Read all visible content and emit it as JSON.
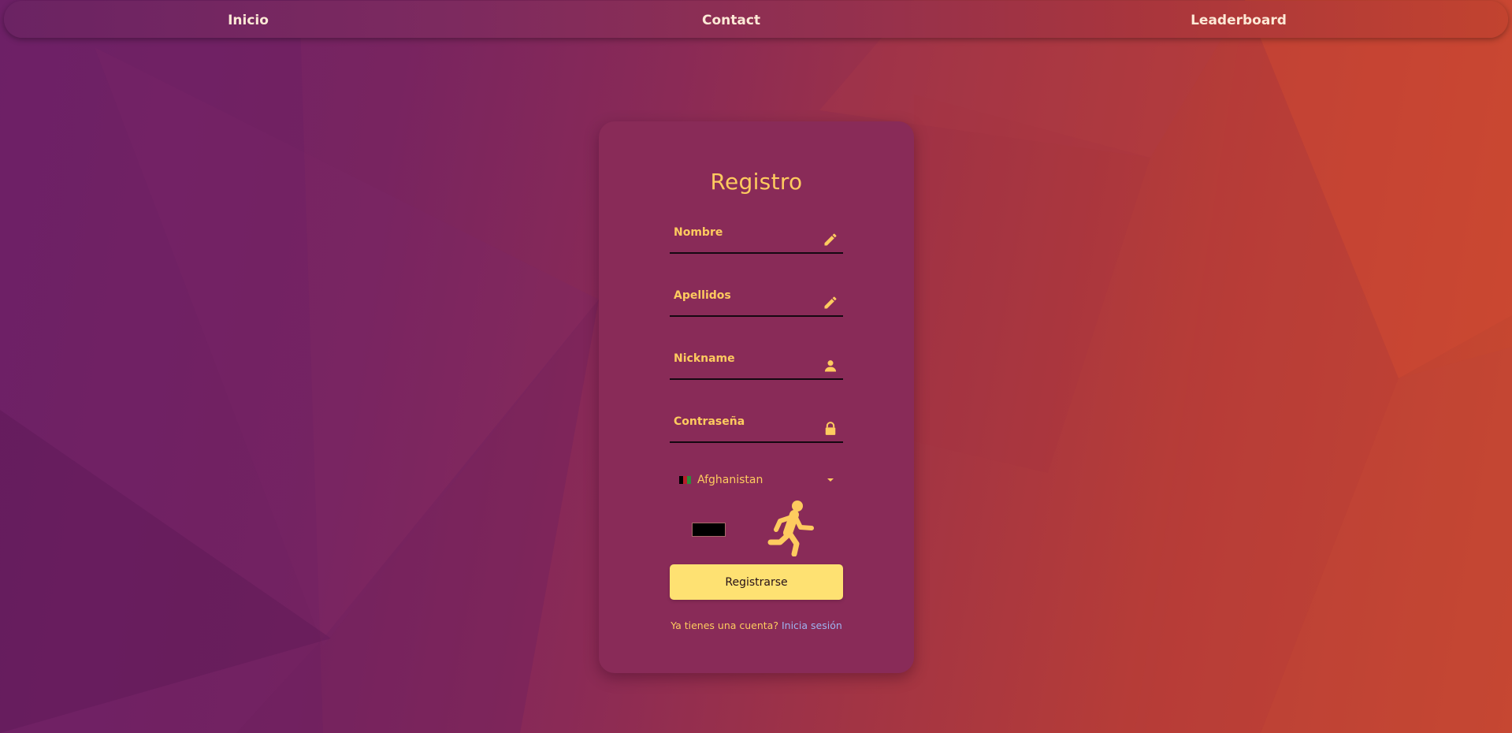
{
  "nav": {
    "inicio": "Inicio",
    "contact": "Contact",
    "leaderboard": "Leaderboard"
  },
  "form": {
    "title": "Registro",
    "fields": [
      {
        "placeholder": "Nombre",
        "value": "",
        "icon": "pencil-icon"
      },
      {
        "placeholder": "Apellidos",
        "value": "",
        "icon": "pencil-icon"
      },
      {
        "placeholder": "Nickname",
        "value": "",
        "icon": "user-icon"
      },
      {
        "placeholder": "Contraseña",
        "value": "",
        "icon": "lock-icon"
      }
    ],
    "country": {
      "selected": "Afghanistan",
      "flag_colors": [
        "#000000",
        "#b81d2b",
        "#2c8a3f"
      ]
    },
    "color_value": "#000000",
    "avatar_icon": "running-man-icon",
    "submit_label": "Registrarse",
    "login_prompt": "Ya tienes una cuenta?",
    "login_link": "Inicia sesión"
  },
  "colors": {
    "accent": "#fecb5f",
    "button": "#fee172",
    "link": "#9eb3f0",
    "card": "#892b58"
  }
}
